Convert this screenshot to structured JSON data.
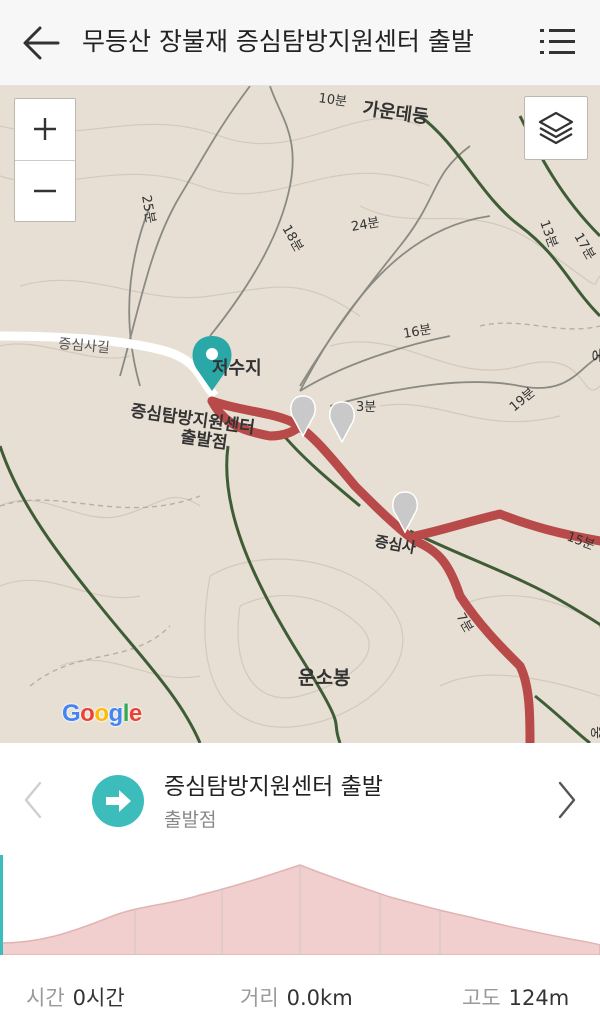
{
  "header": {
    "title": "무등산 장불재 증심탐방지원센터 출발",
    "back_icon": "arrow-left-icon",
    "menu_icon": "list-menu-icon"
  },
  "map": {
    "labels": {
      "ganundeung": "가운데등",
      "t10": "10분",
      "t25": "25분",
      "t18": "18분",
      "t24": "24분",
      "t16": "16분",
      "t19": "19분",
      "t13": "13분",
      "t17": "17분",
      "t15": "15분",
      "t3": "3분",
      "jeungsimsa_road": "증심사길",
      "reservoir": "저수지",
      "start_point_l1": "증심탐방지원센터",
      "start_point_l2": "출발점",
      "jeungsimsa": "증심사",
      "t7": "7분",
      "unsobong": "운소봉",
      "edge_n": "중",
      "edge_s": "중"
    },
    "attribution": "Google",
    "colors": {
      "route": "#b84a4a",
      "trail": "#3e5c36",
      "marker": "#2aa7a7",
      "poi": "#c9c9c9",
      "base": "#e7dfd3"
    }
  },
  "step": {
    "title": "증심탐방지원센터 출발",
    "subtitle": "출발점",
    "icon": "arrow-right-circle-icon"
  },
  "stats": {
    "time_label": "시간",
    "time_value": "0시간",
    "distance_label": "거리",
    "distance_value": "0.0km",
    "altitude_label": "고도",
    "altitude_value": "124m"
  }
}
